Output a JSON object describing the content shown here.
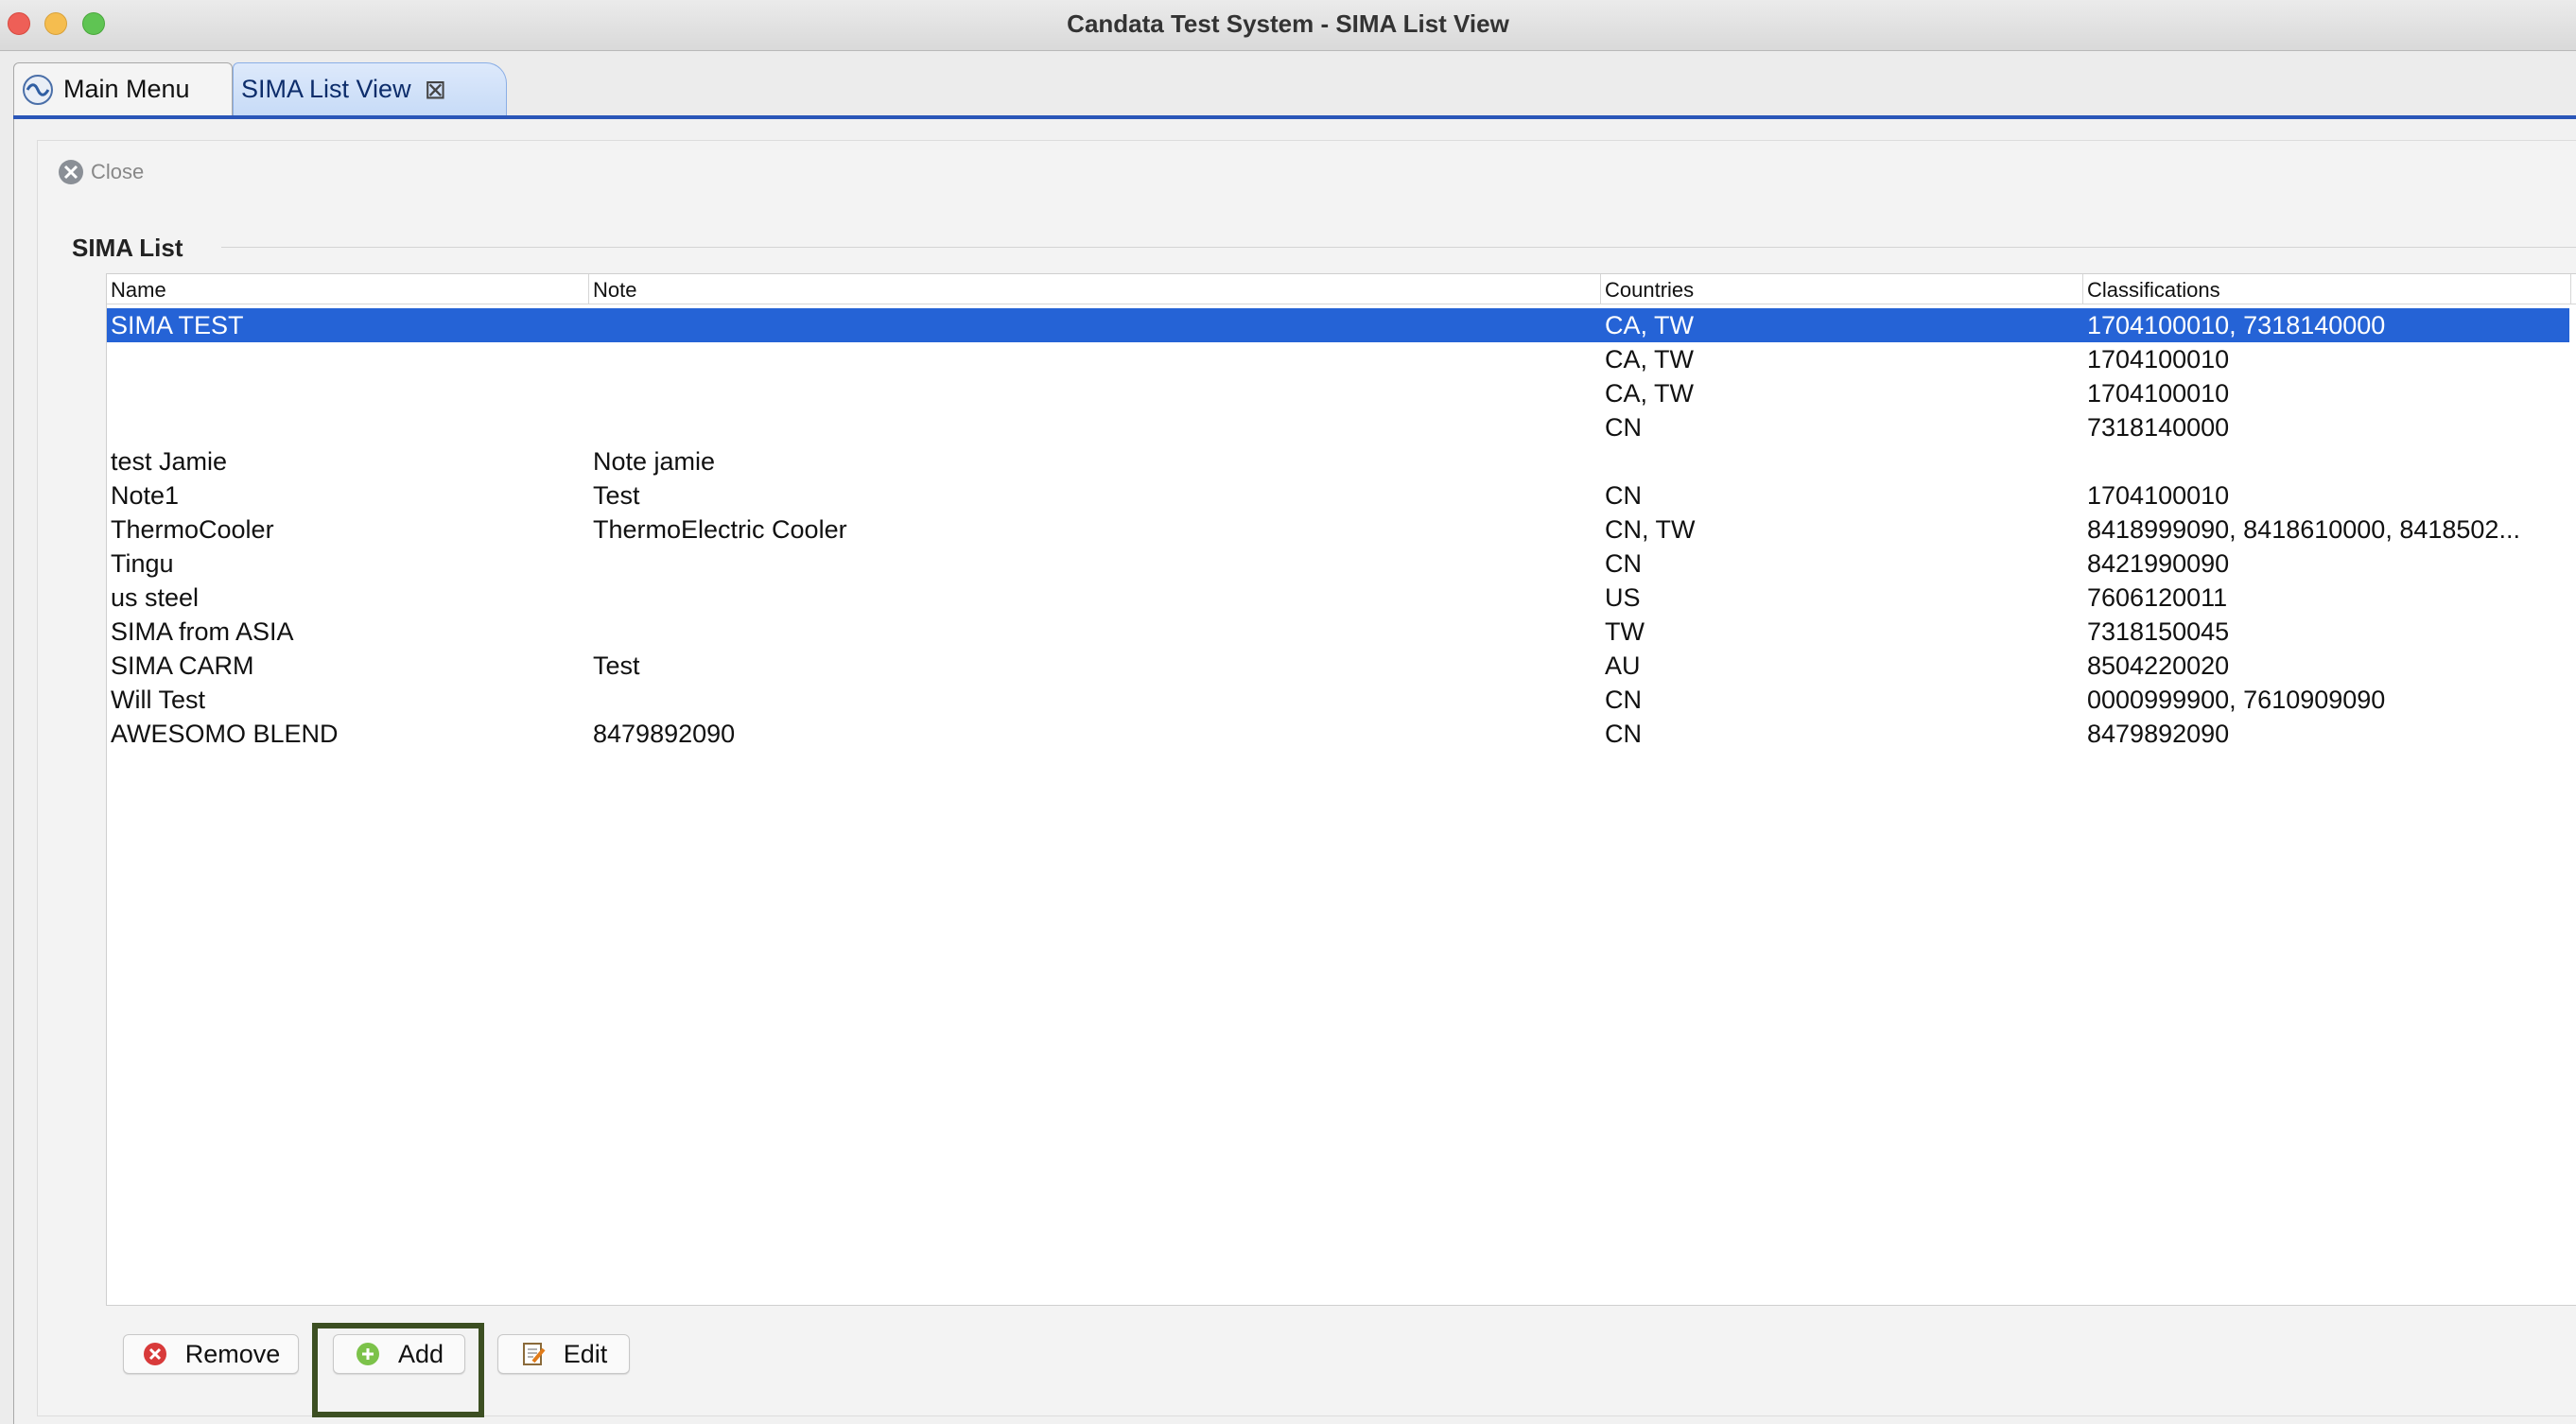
{
  "window": {
    "title": "Candata Test System - SIMA List View"
  },
  "tabs": [
    {
      "label": "Main Menu"
    },
    {
      "label": "SIMA List View"
    }
  ],
  "toolbar": {
    "close_label": "Close"
  },
  "section": {
    "label": "SIMA List"
  },
  "table": {
    "columns": [
      "Name",
      "Note",
      "Countries",
      "Classifications"
    ],
    "rows": [
      [
        "SIMA TEST",
        "",
        "CA, TW",
        "1704100010, 7318140000"
      ],
      [
        "",
        "",
        "CA, TW",
        "1704100010"
      ],
      [
        "",
        "",
        "CA, TW",
        "1704100010"
      ],
      [
        "",
        "",
        "CN",
        "7318140000"
      ],
      [
        "test Jamie",
        "Note jamie",
        "",
        ""
      ],
      [
        "Note1",
        "Test",
        "CN",
        "1704100010"
      ],
      [
        "ThermoCooler",
        "ThermoElectric Cooler",
        "CN, TW",
        "8418999090, 8418610000, 8418502..."
      ],
      [
        "Tingu",
        "",
        "CN",
        "8421990090"
      ],
      [
        "us steel",
        "",
        "US",
        "7606120011"
      ],
      [
        "SIMA from ASIA",
        "",
        "TW",
        "7318150045"
      ],
      [
        "SIMA CARM",
        "Test",
        "AU",
        "8504220020"
      ],
      [
        "Will Test",
        "",
        "CN",
        "0000999900, 7610909090"
      ],
      [
        "AWESOMO BLEND",
        "8479892090",
        "CN",
        "8479892090"
      ]
    ],
    "selected_row": 0
  },
  "buttons": {
    "remove_label": "Remove",
    "add_label": "Add",
    "edit_label": "Edit"
  },
  "colors": {
    "selection": "#2563d6",
    "highlight_box": "#3c4f22",
    "tab_underline": "#2a56b8"
  }
}
